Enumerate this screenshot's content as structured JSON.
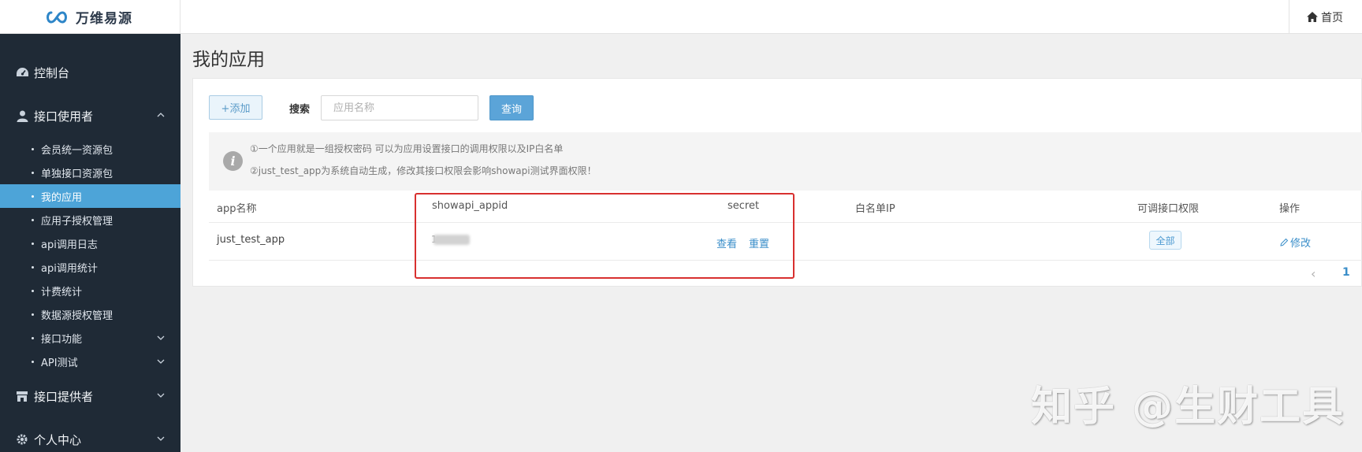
{
  "topbar": {
    "logo_text": "万维易源",
    "home_label": "首页"
  },
  "sidebar": {
    "groups": [
      {
        "label": "控制台",
        "icon": "dashboard-icon"
      },
      {
        "label": "接口使用者",
        "icon": "user-icon",
        "expanded": true
      },
      {
        "label": "接口提供者",
        "icon": "store-icon"
      },
      {
        "label": "个人中心",
        "icon": "gear-icon"
      }
    ],
    "items": [
      {
        "label": "会员统一资源包"
      },
      {
        "label": "单独接口资源包"
      },
      {
        "label": "我的应用",
        "active": true
      },
      {
        "label": "应用子授权管理"
      },
      {
        "label": "api调用日志"
      },
      {
        "label": "api调用统计"
      },
      {
        "label": "计费统计"
      },
      {
        "label": "数据源授权管理"
      },
      {
        "label": "接口功能"
      },
      {
        "label": "API测试"
      }
    ]
  },
  "main": {
    "title": "我的应用",
    "add_label": "+添加",
    "search_label": "搜索",
    "search_placeholder": "应用名称",
    "query_label": "查询",
    "notice": {
      "line1": "①一个应用就是一组授权密码 可以为应用设置接口的调用权限以及IP白名单",
      "line2": "②just_test_app为系统自动生成，修改其接口权限会影响showapi测试界面权限！"
    },
    "table": {
      "headers": [
        "app名称",
        "showapi_appid",
        "secret",
        "白名单IP",
        "可调接口权限",
        "操作"
      ],
      "rows": [
        {
          "app_name": "just_test_app",
          "appid_visible": "1",
          "secret_view": "查看",
          "secret_reset": "重置",
          "whitelist": "",
          "permission": "全部",
          "action": "修改"
        }
      ]
    },
    "pager": {
      "prev": "‹",
      "current": "1"
    }
  },
  "watermark": "知乎 @生财工具",
  "colors": {
    "sidebar_bg": "#1f2a36",
    "active_item": "#4da4d8",
    "primary": "#5ba4d8",
    "highlight": "#d8302f"
  }
}
